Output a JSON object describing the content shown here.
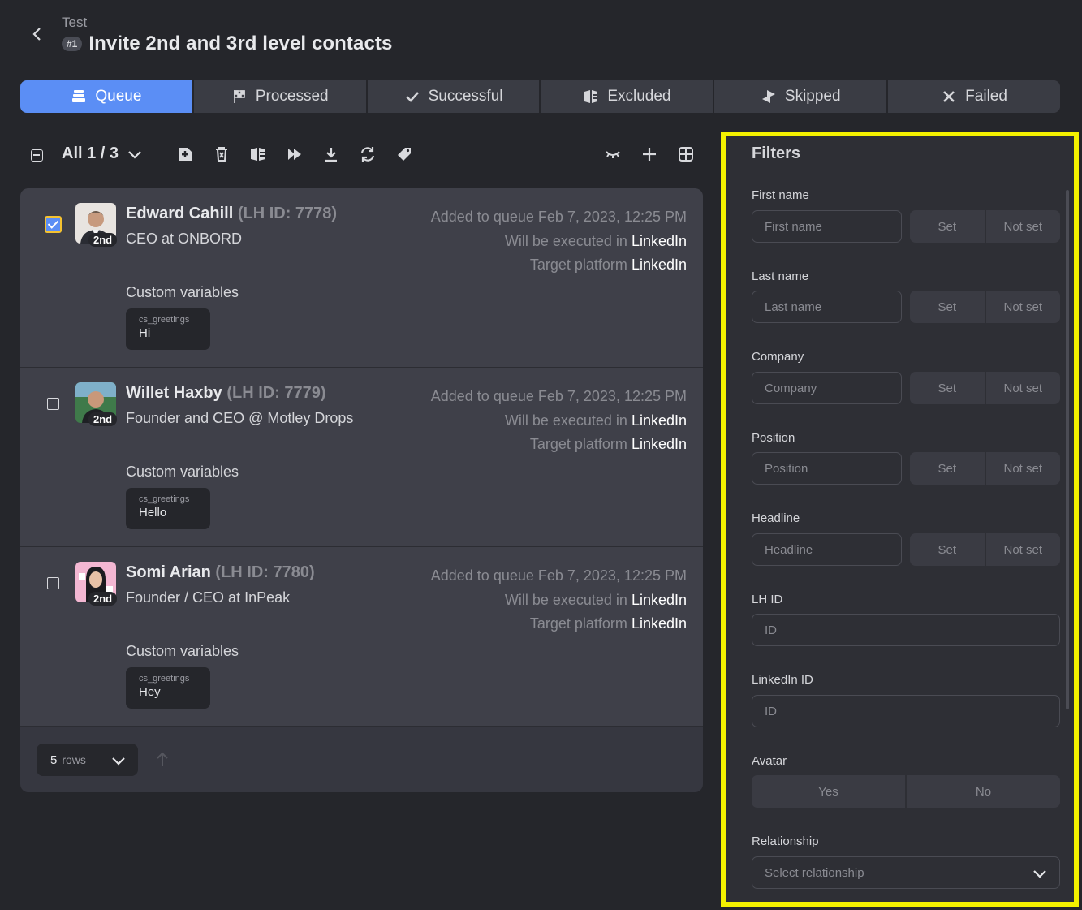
{
  "header": {
    "breadcrumb": "Test",
    "badge": "#1",
    "title": "Invite 2nd and 3rd level contacts"
  },
  "tabs": [
    {
      "label": "Queue",
      "icon": "queue-icon",
      "active": true
    },
    {
      "label": "Processed",
      "icon": "flag-icon",
      "active": false
    },
    {
      "label": "Successful",
      "icon": "check-icon",
      "active": false
    },
    {
      "label": "Excluded",
      "icon": "excluded-icon",
      "active": false
    },
    {
      "label": "Skipped",
      "icon": "skip-icon",
      "active": false
    },
    {
      "label": "Failed",
      "icon": "close-icon",
      "active": false
    }
  ],
  "toolbar": {
    "count_label": "All 1 / 3",
    "icons": [
      "add-icon",
      "trash-icon",
      "exclude-icon",
      "fast-forward-icon",
      "download-icon",
      "refresh-icon",
      "tag-icon",
      "hide-icon",
      "plus-icon",
      "grid-icon"
    ]
  },
  "rows": [
    {
      "name": "Edward Cahill",
      "lh_id": "(LH ID: 7778)",
      "degree": "2nd",
      "role": "CEO at ONBORD",
      "added": "Added to queue Feb 7, 2023, 12:25 PM",
      "executed_prefix": "Will be executed in",
      "executed_platform": "LinkedIn",
      "target_prefix": "Target platform",
      "target_platform": "LinkedIn",
      "custom_vars_label": "Custom variables",
      "var_key": "cs_greetings",
      "var_value": "Hi",
      "checked": true
    },
    {
      "name": "Willet Haxby",
      "lh_id": "(LH ID: 7779)",
      "degree": "2nd",
      "role": "Founder and CEO @ Motley Drops",
      "added": "Added to queue Feb 7, 2023, 12:25 PM",
      "executed_prefix": "Will be executed in",
      "executed_platform": "LinkedIn",
      "target_prefix": "Target platform",
      "target_platform": "LinkedIn",
      "custom_vars_label": "Custom variables",
      "var_key": "cs_greetings",
      "var_value": "Hello",
      "checked": false
    },
    {
      "name": "Somi Arian",
      "lh_id": "(LH ID: 7780)",
      "degree": "2nd",
      "role": "Founder / CEO at InPeak",
      "added": "Added to queue Feb 7, 2023, 12:25 PM",
      "executed_prefix": "Will be executed in",
      "executed_platform": "LinkedIn",
      "target_prefix": "Target platform",
      "target_platform": "LinkedIn",
      "custom_vars_label": "Custom variables",
      "var_key": "cs_greetings",
      "var_value": "Hey",
      "checked": false
    }
  ],
  "pager": {
    "rows_num": "5",
    "rows_label": "rows"
  },
  "filters": {
    "title": "Filters",
    "set_label": "Set",
    "not_set_label": "Not set",
    "first_name": {
      "label": "First name",
      "placeholder": "First name"
    },
    "last_name": {
      "label": "Last name",
      "placeholder": "Last name"
    },
    "company": {
      "label": "Company",
      "placeholder": "Company"
    },
    "position": {
      "label": "Position",
      "placeholder": "Position"
    },
    "headline": {
      "label": "Headline",
      "placeholder": "Headline"
    },
    "lh_id": {
      "label": "LH ID",
      "placeholder": "ID"
    },
    "linkedin_id": {
      "label": "LinkedIn ID",
      "placeholder": "ID"
    },
    "avatar": {
      "label": "Avatar",
      "yes": "Yes",
      "no": "No"
    },
    "relationship": {
      "label": "Relationship",
      "placeholder": "Select relationship"
    }
  },
  "colors": {
    "accent": "#5b8ef5",
    "highlight_border": "#f4f100",
    "background": "#25262b"
  }
}
